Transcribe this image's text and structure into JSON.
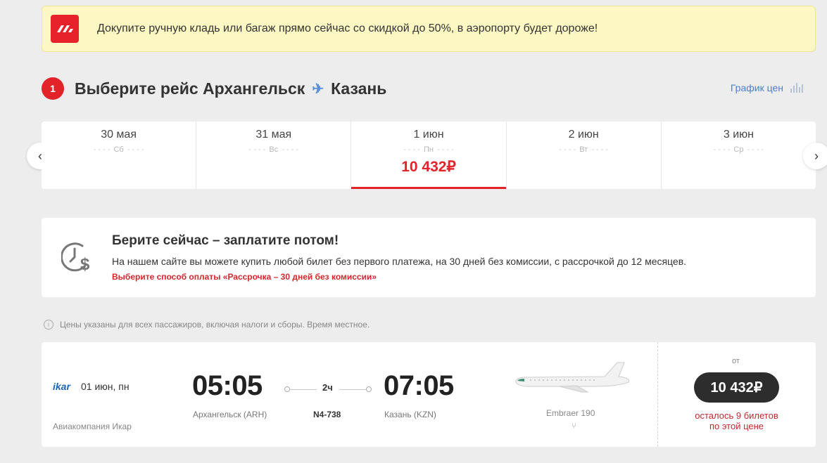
{
  "banner": {
    "text": "Докупите ручную кладь или багаж прямо сейчас со скидкой до 50%, в аэропорту будет дороже!"
  },
  "step": {
    "number": "1",
    "title_prefix": "Выберите рейс Архангельск",
    "destination": "Казань",
    "price_chart_label": "График цен"
  },
  "dates": [
    {
      "day": "30 мая",
      "weekday": "Сб",
      "price": ""
    },
    {
      "day": "31 мая",
      "weekday": "Вс",
      "price": ""
    },
    {
      "day": "1 июн",
      "weekday": "Пн",
      "price": "10 432₽"
    },
    {
      "day": "2 июн",
      "weekday": "Вт",
      "price": ""
    },
    {
      "day": "3 июн",
      "weekday": "Ср",
      "price": ""
    }
  ],
  "selected_date_index": 2,
  "promo": {
    "title": "Берите сейчас – заплатите потом!",
    "description": "На нашем сайте вы можете купить любой билет без первого платежа, на 30 дней без комиссии, с рассрочкой до 12 месяцев.",
    "link": "Выберите способ оплаты «Рассрочка – 30 дней без комиссии»"
  },
  "notice": "Цены указаны для всех пассажиров, включая налоги и сборы. Время местное.",
  "flight": {
    "airline_logo": "ikar",
    "date": "01 июн, пн",
    "airline_name": "Авиакомпания Икар",
    "departure_time": "05:05",
    "arrival_time": "07:05",
    "departure_airport": "Архангельск (ARH)",
    "arrival_airport": "Казань (KZN)",
    "duration": "2ч",
    "flight_number": "N4-738",
    "aircraft": "Embraer 190",
    "price_from": "от",
    "price": "10 432₽",
    "seats_left_line1": "осталось 9 билетов",
    "seats_left_line2": "по этой цене"
  },
  "colors": {
    "accent": "#e2232a",
    "link": "#4a7fd1",
    "banner_bg": "#fcf7c3"
  }
}
